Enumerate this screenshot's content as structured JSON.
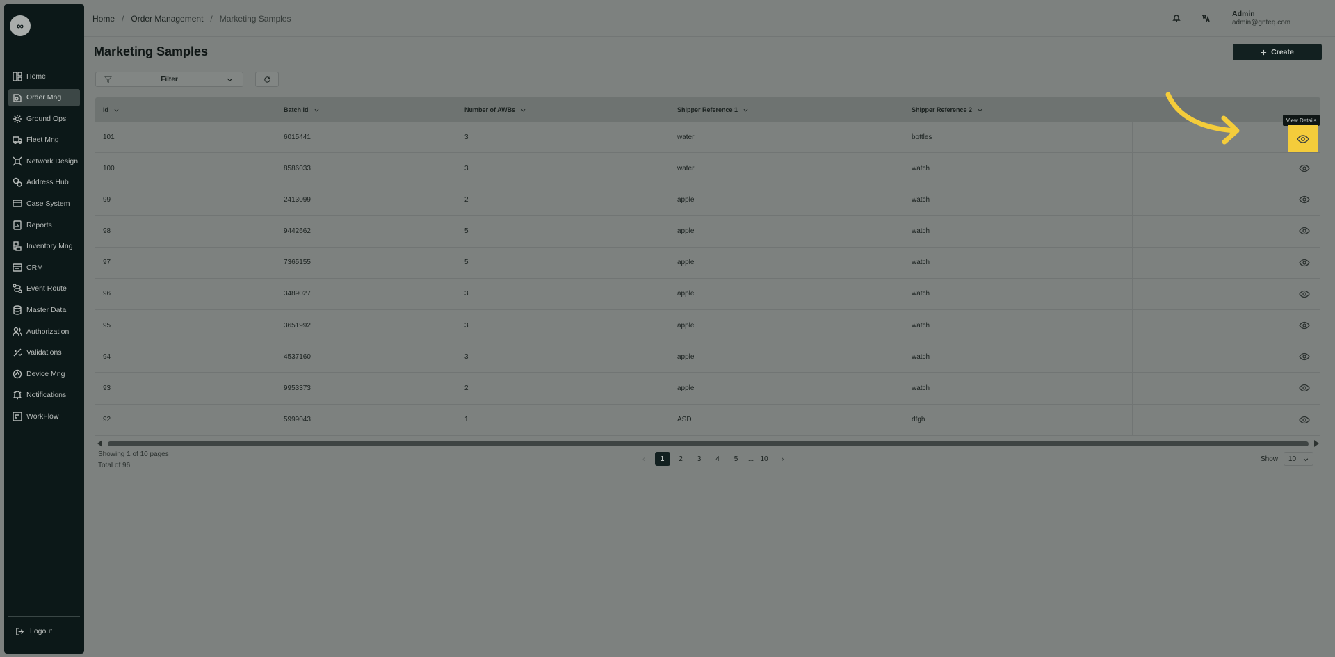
{
  "sidebar": {
    "logo": "∞",
    "items": [
      {
        "label": "Home",
        "icon": "dashboard-icon"
      },
      {
        "label": "Order Mng",
        "icon": "order-icon",
        "active": true
      },
      {
        "label": "Ground Ops",
        "icon": "ground-ops-icon"
      },
      {
        "label": "Fleet Mng",
        "icon": "truck-icon"
      },
      {
        "label": "Network Design",
        "icon": "network-icon"
      },
      {
        "label": "Address Hub",
        "icon": "address-icon"
      },
      {
        "label": "Case System",
        "icon": "case-icon"
      },
      {
        "label": "Reports",
        "icon": "reports-icon"
      },
      {
        "label": "Inventory Mng",
        "icon": "inventory-icon"
      },
      {
        "label": "CRM",
        "icon": "crm-icon"
      },
      {
        "label": "Event Route",
        "icon": "route-icon"
      },
      {
        "label": "Master Data",
        "icon": "database-icon"
      },
      {
        "label": "Authorization",
        "icon": "users-icon"
      },
      {
        "label": "Validations",
        "icon": "validation-icon"
      },
      {
        "label": "Device Mng",
        "icon": "device-icon"
      },
      {
        "label": "Notifications",
        "icon": "bell-icon"
      },
      {
        "label": "WorkFlow",
        "icon": "workflow-icon"
      }
    ],
    "logout": "Logout"
  },
  "header": {
    "breadcrumb": [
      "Home",
      "Order Management",
      "Marketing Samples"
    ],
    "user_name": "Admin",
    "user_email": "admin@gnteq.com"
  },
  "page": {
    "title": "Marketing Samples",
    "create_label": "Create",
    "filter_label": "Filter"
  },
  "table": {
    "columns": [
      "Id",
      "Batch Id",
      "Number of AWBs",
      "Shipper Reference 1",
      "Shipper Reference 2"
    ],
    "rows": [
      [
        "101",
        "6015441",
        "3",
        "water",
        "bottles"
      ],
      [
        "100",
        "8586033",
        "3",
        "water",
        "watch"
      ],
      [
        "99",
        "2413099",
        "2",
        "apple",
        "watch"
      ],
      [
        "98",
        "9442662",
        "5",
        "apple",
        "watch"
      ],
      [
        "97",
        "7365155",
        "5",
        "apple",
        "watch"
      ],
      [
        "96",
        "3489027",
        "3",
        "apple",
        "watch"
      ],
      [
        "95",
        "3651992",
        "3",
        "apple",
        "watch"
      ],
      [
        "94",
        "4537160",
        "3",
        "apple",
        "watch"
      ],
      [
        "93",
        "9953373",
        "2",
        "apple",
        "watch"
      ],
      [
        "92",
        "5999043",
        "1",
        "ASD",
        "dfgh"
      ]
    ],
    "tooltip": "View Details"
  },
  "footer": {
    "showing": "Showing 1 of 10 pages",
    "total": "Total of 96",
    "pages": [
      "1",
      "2",
      "3",
      "4",
      "5",
      "...",
      "10"
    ],
    "show_label": "Show",
    "page_size": "10"
  },
  "colors": {
    "accent": "#122020",
    "highlight": "#f4cc3b"
  }
}
